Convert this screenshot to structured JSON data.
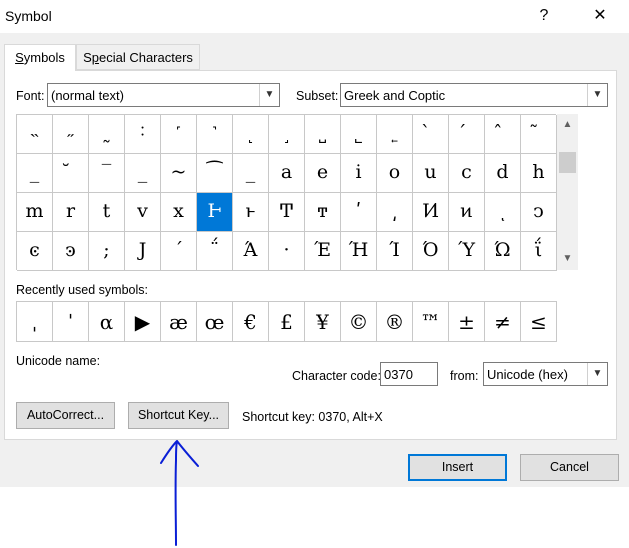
{
  "window": {
    "title": "Symbol",
    "help": "?",
    "close": "✕"
  },
  "tabs": [
    {
      "label": "Symbols",
      "mnemonic_index": 0
    },
    {
      "label": "Special Characters",
      "mnemonic_index": 1
    }
  ],
  "font": {
    "label": "Font:",
    "value": "(normal text)"
  },
  "subset": {
    "label": "Subset:",
    "value": "Greek and Coptic"
  },
  "grid": {
    "rows": [
      [
        "˵",
        "˶",
        "˷",
        "˸",
        "˹",
        "˺",
        "˻",
        "˼",
        "˽",
        "˾",
        "˿",
        "̀",
        "́",
        "̂",
        "̃"
      ],
      [
        "_",
        "̆",
        "‾",
        "_",
        "~",
        "⁀",
        "_",
        "a",
        "e",
        "i",
        "o",
        "u",
        "c",
        "d",
        "h"
      ],
      [
        "m",
        "r",
        "t",
        "v",
        "x",
        "Ͱ",
        "ͱ",
        "Ͳ",
        "ͳ",
        "ʹ",
        "͵",
        "Ͷ",
        "ͷ",
        "ͺ",
        "ͻ"
      ],
      [
        "ͼ",
        "ͽ",
        ";",
        "Ϳ",
        "΄",
        "΅",
        "Ά",
        "·",
        "Έ",
        "Ή",
        "Ί",
        "Ό",
        "Ύ",
        "Ώ",
        "ΐ"
      ]
    ],
    "selected": {
      "row": 2,
      "col": 5
    }
  },
  "recent": {
    "label": "Recently used symbols:",
    "symbols": [
      "ˌ",
      "ˈ",
      "α",
      "▶",
      "æ",
      "œ",
      "€",
      "£",
      "¥",
      "©",
      "®",
      "™",
      "±",
      "≠",
      "≤"
    ]
  },
  "unicode_name": {
    "label": "Unicode name:"
  },
  "character_code": {
    "label": "Character code:",
    "value": "0370"
  },
  "from": {
    "label": "from:",
    "value": "Unicode (hex)"
  },
  "buttons": {
    "autocorrect": "AutoCorrect...",
    "shortcut_key": "Shortcut Key...",
    "insert": "Insert",
    "cancel": "Cancel"
  },
  "shortcut_text": "Shortcut key: 0370, Alt+X",
  "annotation": {
    "color": "#0a1fd6"
  }
}
